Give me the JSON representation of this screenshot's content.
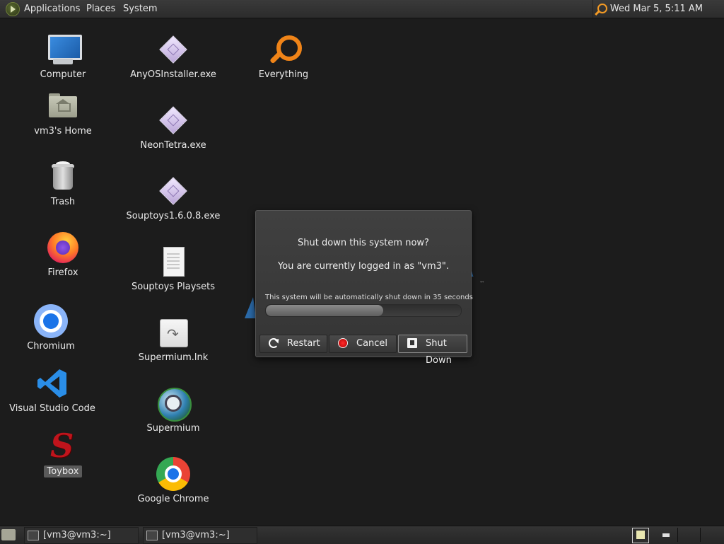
{
  "top_panel": {
    "menu": [
      "Applications",
      "Places",
      "System"
    ],
    "clock": "Wed Mar  5,  5:11 AM"
  },
  "desktop_icons": [
    {
      "label": "Computer",
      "icon": "computer-icon"
    },
    {
      "label": "vm3's Home",
      "icon": "home-folder-icon"
    },
    {
      "label": "Trash",
      "icon": "trash-icon"
    },
    {
      "label": "Firefox",
      "icon": "firefox-icon"
    },
    {
      "label": "Chromium",
      "icon": "chromium-icon"
    },
    {
      "label": "Visual Studio Code",
      "icon": "vscode-icon"
    },
    {
      "label": "Toybox",
      "icon": "toybox-icon"
    },
    {
      "label": "AnyOSInstaller.exe",
      "icon": "exe-icon"
    },
    {
      "label": "NeonTetra.exe",
      "icon": "exe-icon"
    },
    {
      "label": "Souptoys1.6.0.8.exe",
      "icon": "exe-icon"
    },
    {
      "label": "Souptoys Playsets",
      "icon": "document-icon"
    },
    {
      "label": "Supermium.lnk",
      "icon": "shortcut-icon"
    },
    {
      "label": "Supermium",
      "icon": "supermium-icon"
    },
    {
      "label": "Google Chrome",
      "icon": "chrome-icon"
    },
    {
      "label": "Everything",
      "icon": "search-icon"
    }
  ],
  "dialog": {
    "title": "Shut down this system now?",
    "message": "You are currently logged in as \"vm3\".",
    "countdown": "This system will be automatically shut down in 35 seconds",
    "progress": 0.6,
    "buttons": {
      "restart": "Restart",
      "cancel": "Cancel",
      "shutdown": "Shut Down"
    }
  },
  "taskbar": {
    "tasks": [
      "[vm3@vm3:~]",
      "[vm3@vm3:~]"
    ]
  },
  "colors": {
    "desktop_bg": "#1c1c1c",
    "accent_orange": "#f08418",
    "cancel_red": "#e00000"
  }
}
